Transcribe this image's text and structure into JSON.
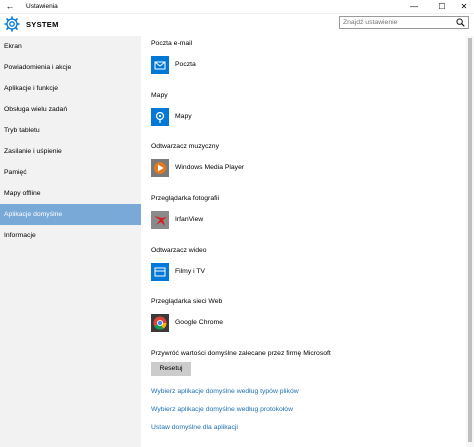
{
  "window": {
    "title": "Ustawienia",
    "back_glyph": "←",
    "minimize_glyph": "—",
    "maximize_glyph": "☐",
    "close_glyph": "✕"
  },
  "header": {
    "section_title": "SYSTEM",
    "icon": "gear-icon",
    "search_placeholder": "Znajdź ustawienie",
    "search_icon": "search-icon"
  },
  "sidebar": {
    "items": [
      {
        "label": "Ekran"
      },
      {
        "label": "Powiadomienia i akcje"
      },
      {
        "label": "Aplikacje i funkcje"
      },
      {
        "label": "Obsługa wielu zadań"
      },
      {
        "label": "Tryb tabletu"
      },
      {
        "label": "Zasilanie i uśpienie"
      },
      {
        "label": "Pamięć"
      },
      {
        "label": "Mapy offline"
      },
      {
        "label": "Aplikacje domyślne",
        "selected": true
      },
      {
        "label": "Informacje"
      }
    ]
  },
  "main": {
    "groups": [
      {
        "label": "Poczta e-mail",
        "app": "Poczta",
        "icon": "mail-icon"
      },
      {
        "label": "Mapy",
        "app": "Mapy",
        "icon": "maps-icon"
      },
      {
        "label": "Odtwarzacz muzyczny",
        "app": "Windows Media Player",
        "icon": "media-player-icon"
      },
      {
        "label": "Przeglądarka fotografii",
        "app": "IrfanView",
        "icon": "irfanview-icon"
      },
      {
        "label": "Odtwarzacz wideo",
        "app": "Filmy i TV",
        "icon": "films-tv-icon"
      },
      {
        "label": "Przeglądarka sieci Web",
        "app": "Google Chrome",
        "icon": "chrome-icon"
      }
    ],
    "reset_text": "Przywróć wartości domyślne zalecane przez firmę Microsoft",
    "reset_button": "Resetuj",
    "links": [
      "Wybierz aplikacje domyślne według typów plików",
      "Wybierz aplikacje domyślne według protokołów",
      "Ustaw domyślne dla aplikacji"
    ]
  },
  "colors": {
    "accent": "#0078d7",
    "selected_nav": "#79a9d6",
    "link": "#1f6fb5",
    "sidebar_bg": "#f2f2f2"
  }
}
